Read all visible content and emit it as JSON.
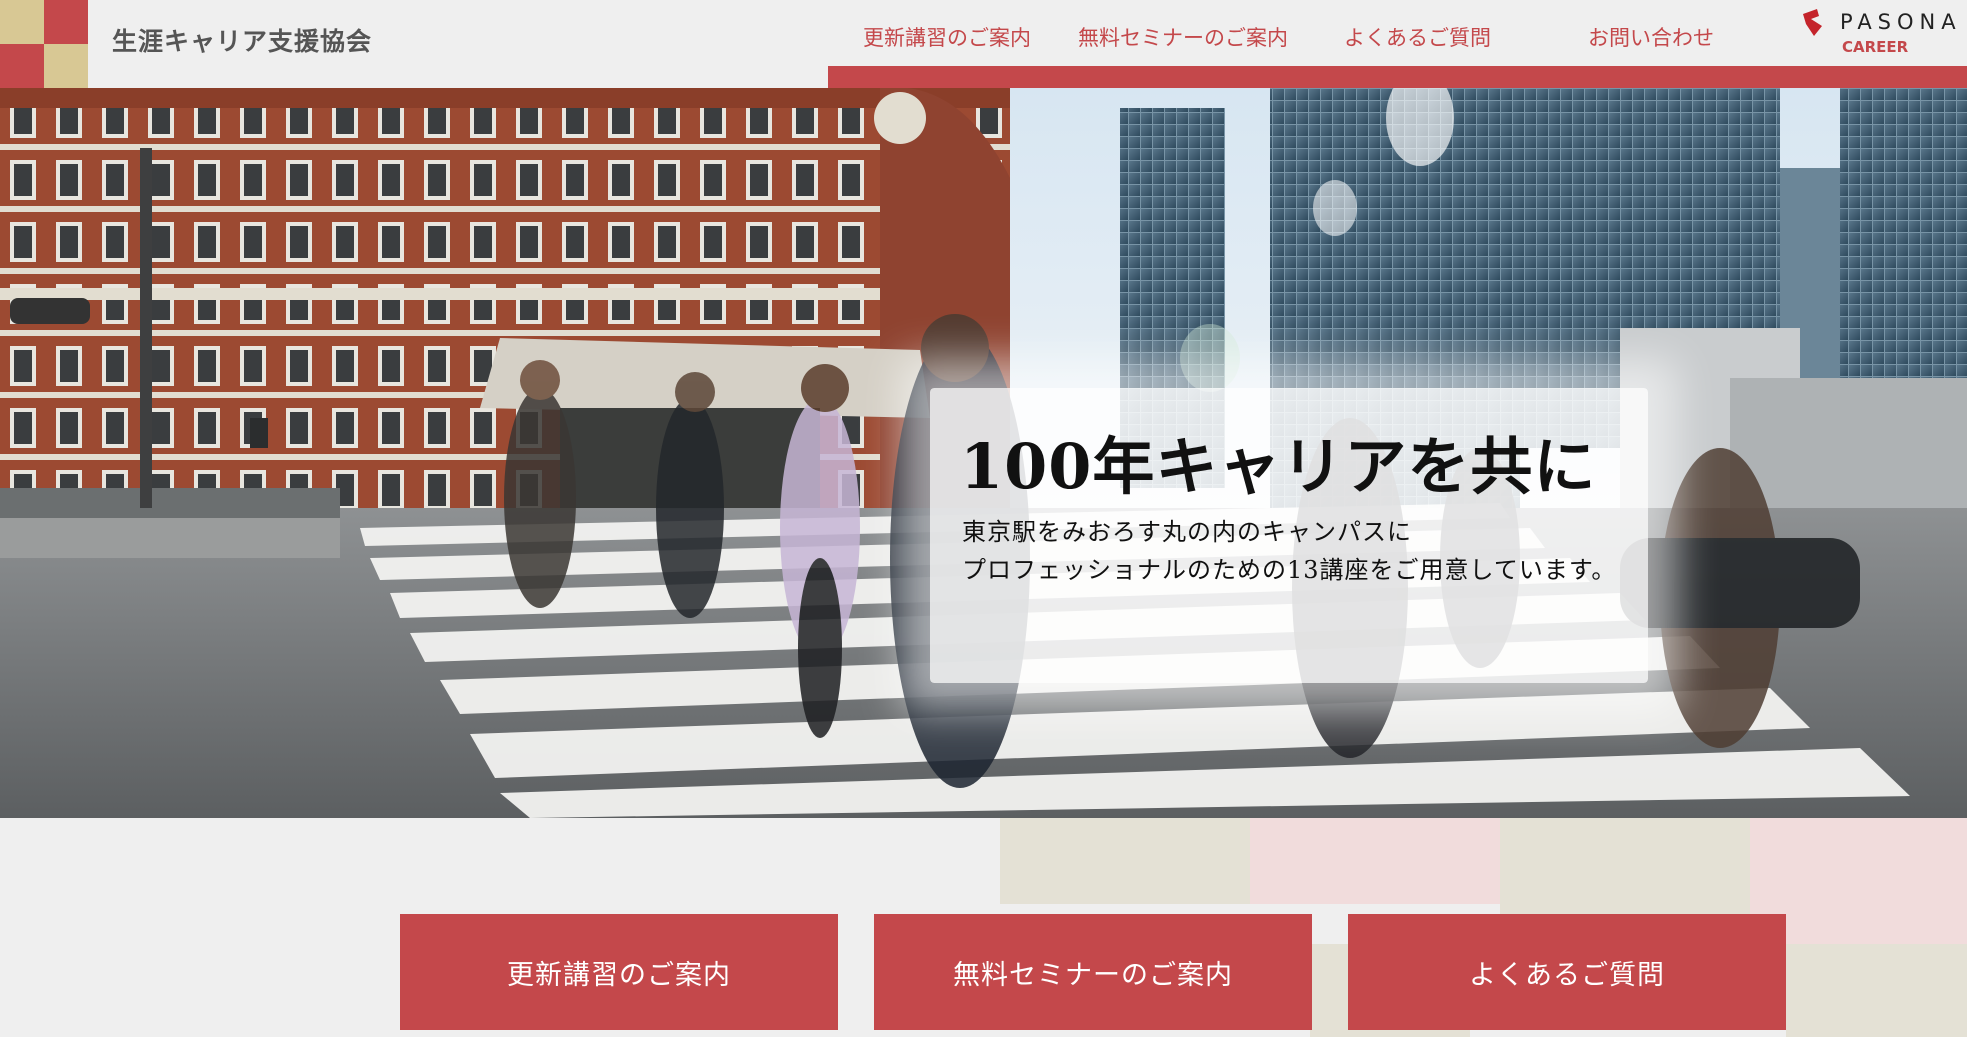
{
  "header": {
    "site_name": "生涯キャリア支援協会",
    "logo_colors": [
      "#d8c894",
      "#c4484b",
      "#c4484b",
      "#d8c894"
    ]
  },
  "nav": {
    "items": [
      {
        "label": "更新講習のご案内"
      },
      {
        "label": "無料セミナーのご案内"
      },
      {
        "label": "よくあるご質問"
      },
      {
        "label": "お問い合わせ"
      }
    ]
  },
  "brand": {
    "name": "PASONA",
    "sub": "CAREER"
  },
  "hero": {
    "title": "100年キャリアを共に",
    "subtitle_line1": "東京駅をみおろす丸の内のキャンパスに",
    "subtitle_line2": "プロフェッショナルのための13講座をご用意しています。"
  },
  "cta": {
    "buttons": [
      {
        "label": "更新講習のご案内"
      },
      {
        "label": "無料セミナーのご案内"
      },
      {
        "label": "よくあるご質問"
      }
    ]
  },
  "colors": {
    "accent": "#c4484b",
    "gold": "#d8c894",
    "background": "#efefef"
  }
}
